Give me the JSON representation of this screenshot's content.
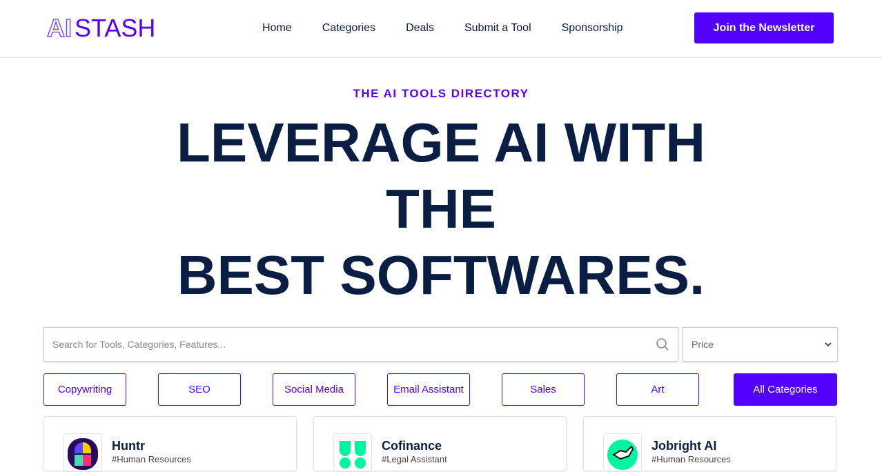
{
  "header": {
    "logo_ai": "AI",
    "logo_stash": "STASH",
    "nav": [
      "Home",
      "Categories",
      "Deals",
      "Submit a Tool",
      "Sponsorship"
    ],
    "cta": "Join the Newsletter"
  },
  "hero": {
    "eyebrow": "THE AI TOOLS DIRECTORY",
    "line1": "LEVERAGE AI WITH",
    "line2": "THE",
    "line3": "BEST SOFTWARES."
  },
  "search": {
    "placeholder": "Search for Tools, Categories, Features...",
    "price_selected": "Price",
    "search_icon": "magnifier-icon"
  },
  "categories": [
    "Copywriting",
    "SEO",
    "Social Media",
    "Email Assistant",
    "Sales",
    "Art",
    "All Categories"
  ],
  "cards": [
    {
      "name": "Huntr",
      "tag": "#Human Resources"
    },
    {
      "name": "Cofinance",
      "tag": "#Legal Assistant"
    },
    {
      "name": "Jobright AI",
      "tag": "#Human Resources"
    }
  ],
  "colors": {
    "accent": "#5200ff",
    "heading": "#0a1e44"
  }
}
